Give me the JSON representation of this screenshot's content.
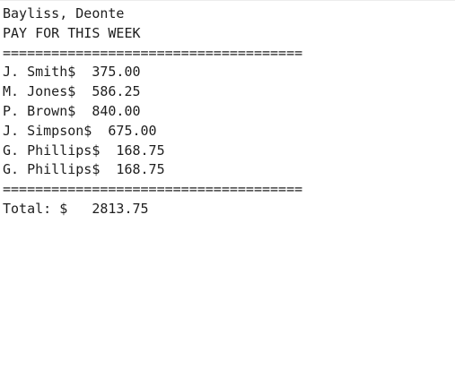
{
  "console": {
    "lines": [
      "Bayliss, Deonte",
      "PAY FOR THIS WEEK",
      "=====================================",
      "J. Smith$  375.00",
      "M. Jones$  586.25",
      "P. Brown$  840.00",
      "J. Simpson$  675.00",
      "G. Phillips$  168.75",
      "G. Phillips$  168.75",
      "=====================================",
      "Total: $   2813.75"
    ]
  }
}
